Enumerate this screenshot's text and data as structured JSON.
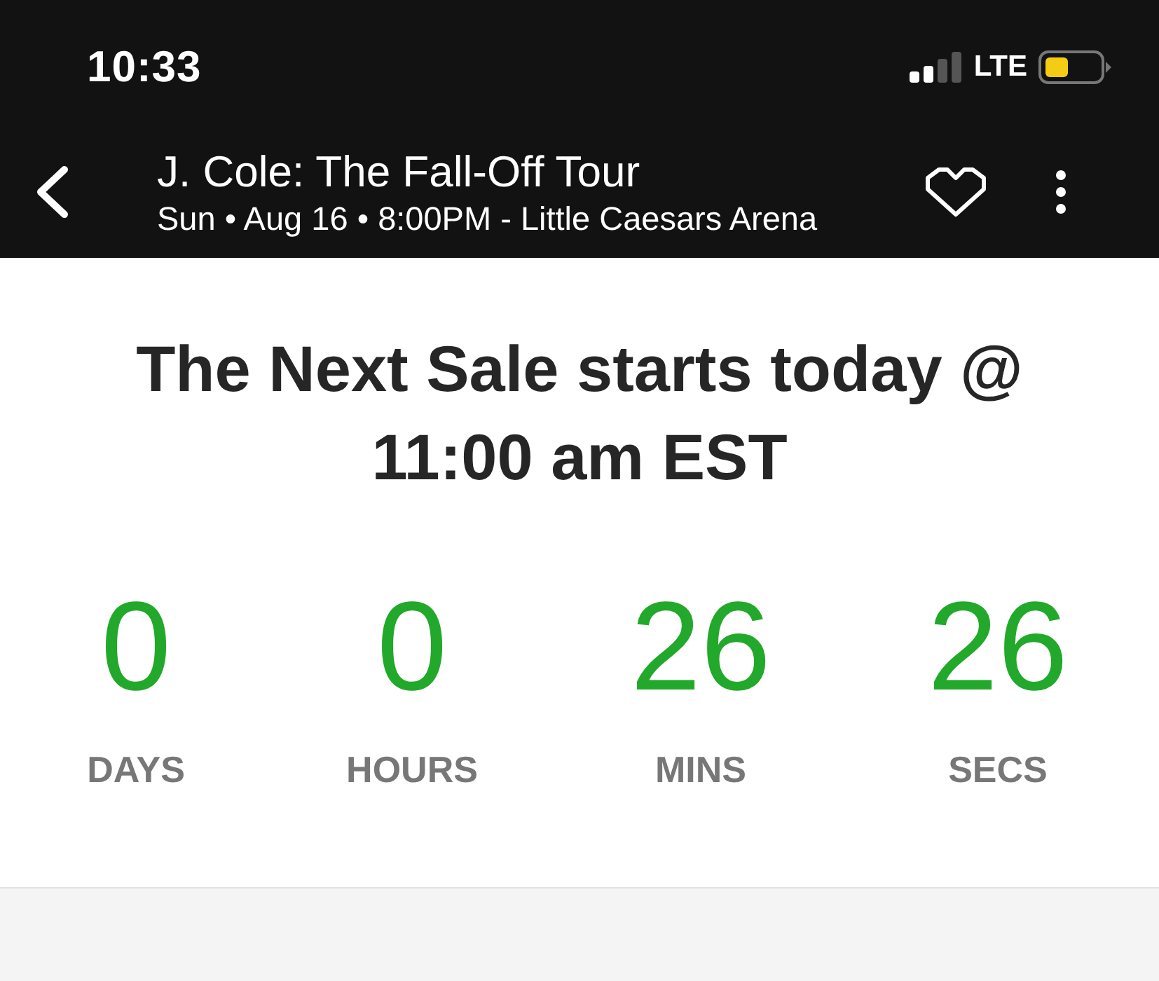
{
  "status_bar": {
    "time": "10:33",
    "network": "LTE"
  },
  "header": {
    "title": "J. Cole: The Fall-Off Tour",
    "subtitle": "Sun • Aug 16 • 8:00PM - Little Caesars Arena"
  },
  "sale": {
    "heading": "The Next Sale starts today @ 11:00 am EST",
    "countdown": [
      {
        "value": "0",
        "unit": "DAYS"
      },
      {
        "value": "0",
        "unit": "HOURS"
      },
      {
        "value": "26",
        "unit": "MINS"
      },
      {
        "value": "26",
        "unit": "SECS"
      }
    ]
  }
}
